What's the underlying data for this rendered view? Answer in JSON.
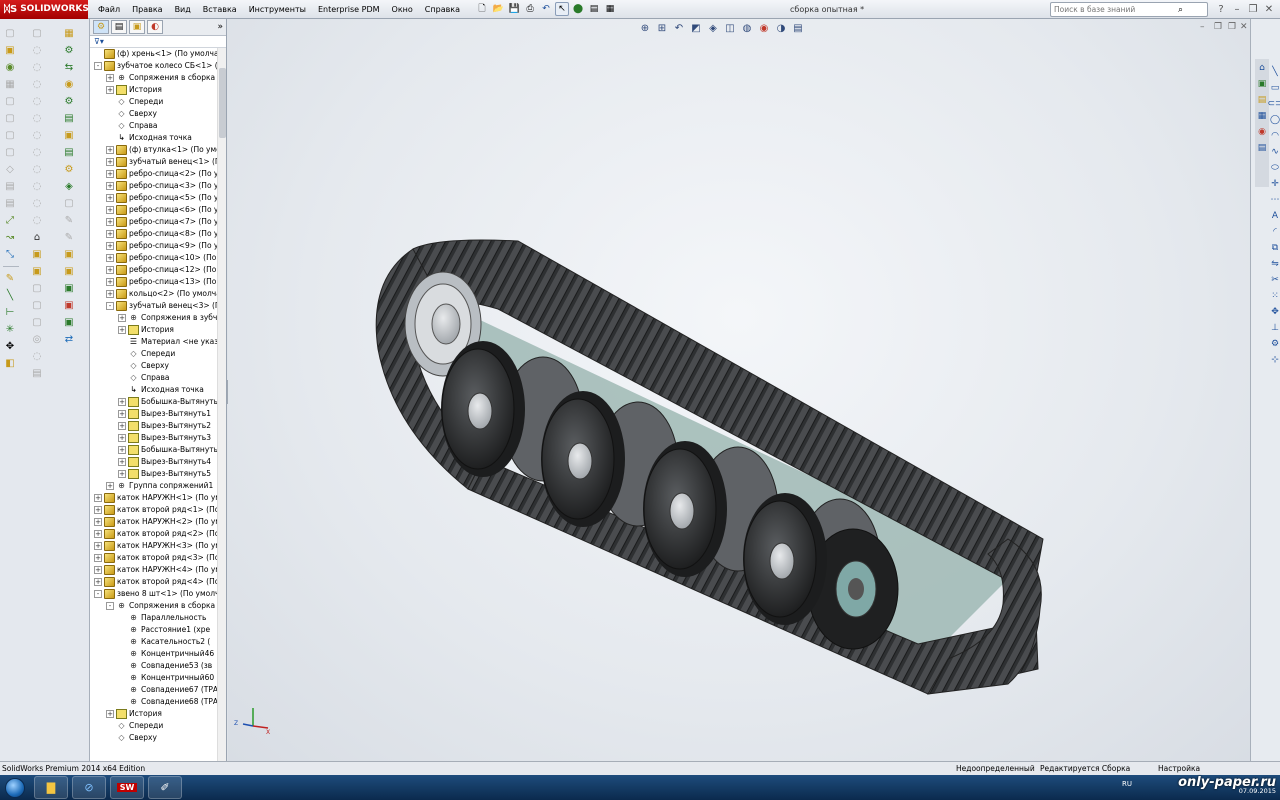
{
  "app": {
    "brand": "SOLIDWORKS",
    "doc_title": "сборка опытная *",
    "edition": "SolidWorks Premium 2014 x64 Edition"
  },
  "menu": [
    "Файл",
    "Правка",
    "Вид",
    "Вставка",
    "Инструменты",
    "Enterprise PDM",
    "Окно",
    "Справка"
  ],
  "search": {
    "placeholder": "Поиск в базе знаний"
  },
  "feature_tree": {
    "filter_icon": "funnel-icon",
    "rows": [
      {
        "indent": 0,
        "toggle": "",
        "icon": "part",
        "label": "(ф) хрень<1> (По умолчан"
      },
      {
        "indent": 0,
        "toggle": "-",
        "icon": "part",
        "label": "зубчатое колесо СБ<1> (П"
      },
      {
        "indent": 1,
        "toggle": "+",
        "icon": "mate",
        "label": "Сопряжения в сборка с"
      },
      {
        "indent": 1,
        "toggle": "+",
        "icon": "feat",
        "label": "История"
      },
      {
        "indent": 1,
        "toggle": "",
        "icon": "plane",
        "label": "Спереди"
      },
      {
        "indent": 1,
        "toggle": "",
        "icon": "plane",
        "label": "Сверху"
      },
      {
        "indent": 1,
        "toggle": "",
        "icon": "plane",
        "label": "Справа"
      },
      {
        "indent": 1,
        "toggle": "",
        "icon": "origin",
        "label": "Исходная точка"
      },
      {
        "indent": 1,
        "toggle": "+",
        "icon": "part",
        "label": "(ф) втулка<1> (По умол"
      },
      {
        "indent": 1,
        "toggle": "+",
        "icon": "part",
        "label": "зубчатый венец<1> (По"
      },
      {
        "indent": 1,
        "toggle": "+",
        "icon": "part",
        "label": "ребро-спица<2> (По ум"
      },
      {
        "indent": 1,
        "toggle": "+",
        "icon": "part",
        "label": "ребро-спица<3> (По ум"
      },
      {
        "indent": 1,
        "toggle": "+",
        "icon": "part",
        "label": "ребро-спица<5> (По ум"
      },
      {
        "indent": 1,
        "toggle": "+",
        "icon": "part",
        "label": "ребро-спица<6> (По ум"
      },
      {
        "indent": 1,
        "toggle": "+",
        "icon": "part",
        "label": "ребро-спица<7> (По ум"
      },
      {
        "indent": 1,
        "toggle": "+",
        "icon": "part",
        "label": "ребро-спица<8> (По ум"
      },
      {
        "indent": 1,
        "toggle": "+",
        "icon": "part",
        "label": "ребро-спица<9> (По ум"
      },
      {
        "indent": 1,
        "toggle": "+",
        "icon": "part",
        "label": "ребро-спица<10> (По у"
      },
      {
        "indent": 1,
        "toggle": "+",
        "icon": "part",
        "label": "ребро-спица<12> (По у"
      },
      {
        "indent": 1,
        "toggle": "+",
        "icon": "part",
        "label": "ребро-спица<13> (По у"
      },
      {
        "indent": 1,
        "toggle": "+",
        "icon": "part",
        "label": "кольцо<2> (По умолча"
      },
      {
        "indent": 1,
        "toggle": "-",
        "icon": "part",
        "label": "зубчатый венец<3> (По"
      },
      {
        "indent": 2,
        "toggle": "+",
        "icon": "mate",
        "label": "Сопряжения в зубча"
      },
      {
        "indent": 2,
        "toggle": "+",
        "icon": "feat",
        "label": "История"
      },
      {
        "indent": 2,
        "toggle": "",
        "icon": "material",
        "label": "Материал <не указа"
      },
      {
        "indent": 2,
        "toggle": "",
        "icon": "plane",
        "label": "Спереди"
      },
      {
        "indent": 2,
        "toggle": "",
        "icon": "plane",
        "label": "Сверху"
      },
      {
        "indent": 2,
        "toggle": "",
        "icon": "plane",
        "label": "Справа"
      },
      {
        "indent": 2,
        "toggle": "",
        "icon": "origin",
        "label": "Исходная точка"
      },
      {
        "indent": 2,
        "toggle": "+",
        "icon": "feat",
        "label": "Бобышка-Вытянуть"
      },
      {
        "indent": 2,
        "toggle": "+",
        "icon": "feat",
        "label": "Вырез-Вытянуть1"
      },
      {
        "indent": 2,
        "toggle": "+",
        "icon": "feat",
        "label": "Вырез-Вытянуть2"
      },
      {
        "indent": 2,
        "toggle": "+",
        "icon": "feat",
        "label": "Вырез-Вытянуть3"
      },
      {
        "indent": 2,
        "toggle": "+",
        "icon": "feat",
        "label": "Бобышка-Вытянуть"
      },
      {
        "indent": 2,
        "toggle": "+",
        "icon": "feat",
        "label": "Вырез-Вытянуть4"
      },
      {
        "indent": 2,
        "toggle": "+",
        "icon": "feat",
        "label": "Вырез-Вытянуть5"
      },
      {
        "indent": 1,
        "toggle": "+",
        "icon": "mate",
        "label": "Группа сопряжений1"
      },
      {
        "indent": 0,
        "toggle": "+",
        "icon": "part",
        "label": "каток НАРУЖН<1> (По ум"
      },
      {
        "indent": 0,
        "toggle": "+",
        "icon": "part",
        "label": "каток  второй ряд<1> (По у"
      },
      {
        "indent": 0,
        "toggle": "+",
        "icon": "part",
        "label": "каток НАРУЖН<2> (По ум"
      },
      {
        "indent": 0,
        "toggle": "+",
        "icon": "part",
        "label": "каток  второй ряд<2> (По у"
      },
      {
        "indent": 0,
        "toggle": "+",
        "icon": "part",
        "label": "каток НАРУЖН<3> (По ум"
      },
      {
        "indent": 0,
        "toggle": "+",
        "icon": "part",
        "label": "каток  второй ряд<3> (По у"
      },
      {
        "indent": 0,
        "toggle": "+",
        "icon": "part",
        "label": "каток НАРУЖН<4> (По ум"
      },
      {
        "indent": 0,
        "toggle": "+",
        "icon": "part",
        "label": "каток  второй ряд<4> (По у"
      },
      {
        "indent": 0,
        "toggle": "-",
        "icon": "part",
        "label": "звено 8 шт<1> (По умолча"
      },
      {
        "indent": 1,
        "toggle": "-",
        "icon": "mate",
        "label": "Сопряжения в сборка с"
      },
      {
        "indent": 2,
        "toggle": "",
        "icon": "mate",
        "label": "Параллельность"
      },
      {
        "indent": 2,
        "toggle": "",
        "icon": "mate",
        "label": "Расстояние1 (хре"
      },
      {
        "indent": 2,
        "toggle": "",
        "icon": "mate",
        "label": "Касательность2 ("
      },
      {
        "indent": 2,
        "toggle": "",
        "icon": "mate",
        "label": "Концентричный46 ("
      },
      {
        "indent": 2,
        "toggle": "",
        "icon": "mate",
        "label": "Совпадение53 (зв"
      },
      {
        "indent": 2,
        "toggle": "",
        "icon": "mate",
        "label": "Концентричный60 ("
      },
      {
        "indent": 2,
        "toggle": "",
        "icon": "mate",
        "label": "Совпадение67 (ТРА"
      },
      {
        "indent": 2,
        "toggle": "",
        "icon": "mate",
        "label": "Совпадение68 (ТРА"
      },
      {
        "indent": 1,
        "toggle": "+",
        "icon": "feat",
        "label": "История"
      },
      {
        "indent": 1,
        "toggle": "",
        "icon": "plane",
        "label": "Спереди"
      },
      {
        "indent": 1,
        "toggle": "",
        "icon": "plane",
        "label": "Сверху"
      }
    ]
  },
  "status": {
    "definition": "Недоопределенный",
    "mode": "Редактируется Сборка",
    "custom": "Настройка"
  },
  "taskbar": {
    "lang": "RU",
    "date": "07.09.2015",
    "watermark": "only-paper.ru"
  },
  "colors": {
    "accent": "#c00000",
    "track": "#3b3d3f",
    "wheel": "#2b2d2f",
    "hub": "#c9ccd0",
    "frame_teal": "#9ab5b0"
  }
}
